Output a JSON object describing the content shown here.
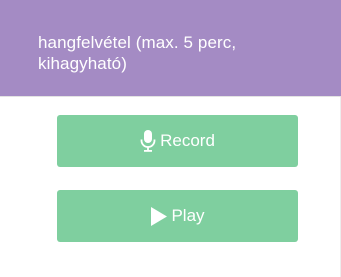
{
  "header": {
    "title": "hangfelvétel (max. 5 perc, kihagyható)"
  },
  "buttons": {
    "record": {
      "label": "Record",
      "icon": "microphone-icon"
    },
    "play": {
      "label": "Play",
      "icon": "play-icon"
    }
  },
  "colors": {
    "header_bg": "#a48bc4",
    "button_bg": "#7fcf9f",
    "text_on_accent": "#ffffff"
  }
}
